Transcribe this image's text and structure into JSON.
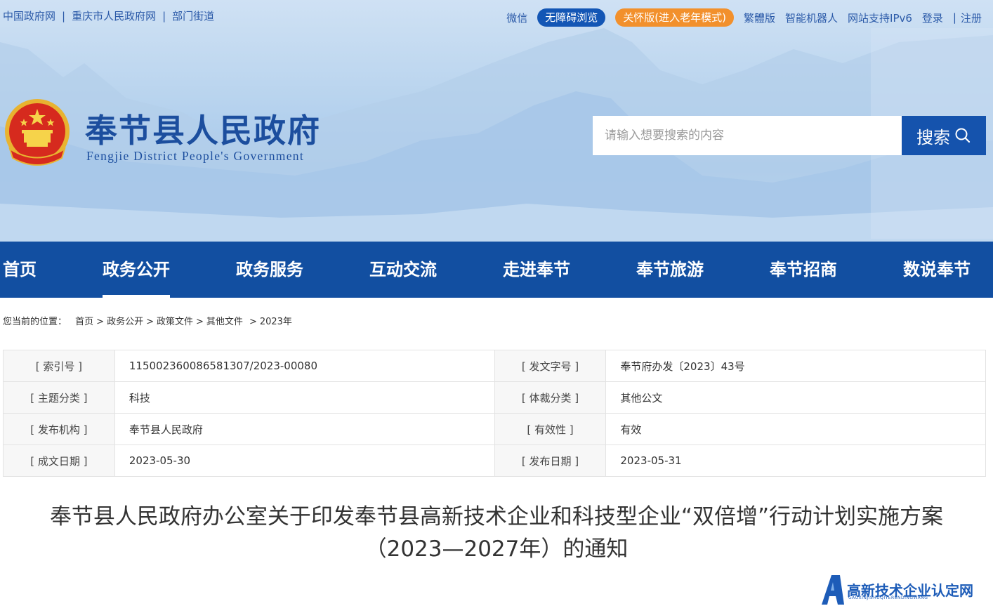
{
  "topbar": {
    "left_links": [
      "中国政府网",
      "重庆市人民政府网",
      "部门街道"
    ],
    "right": {
      "wechat": "微信",
      "accessible": "无障碍浏览",
      "elderly": "关怀版(进入老年模式)",
      "traditional": "繁體版",
      "robot": "智能机器人",
      "ipv6": "网站支持IPv6",
      "login": "登录",
      "register": "注册"
    }
  },
  "site": {
    "title": "奉节县人民政府",
    "subtitle": "Fengjie District People's Government"
  },
  "search": {
    "placeholder": "请输入想要搜索的内容",
    "button": "搜索"
  },
  "nav": {
    "items": [
      "首页",
      "政务公开",
      "政务服务",
      "互动交流",
      "走进奉节",
      "奉节旅游",
      "奉节招商",
      "数说奉节"
    ],
    "active_index": 1
  },
  "breadcrumb": {
    "prefix": "您当前的位置：",
    "items": [
      "首页",
      "政务公开",
      "政策文件",
      "其他文件",
      "2023年"
    ]
  },
  "meta": {
    "rows": [
      {
        "k1": "[ 索引号 ]",
        "v1": "11500236008658130​7/2023-00080",
        "k2": "[ 发文字号 ]",
        "v2": "奉节府办发〔2023〕43号"
      },
      {
        "k1": "[ 主题分类 ]",
        "v1": "科技",
        "k2": "[ 体裁分类 ]",
        "v2": "其他公文"
      },
      {
        "k1": "[ 发布机构 ]",
        "v1": "奉节县人民政府",
        "k2": "[ 有效性 ]",
        "v2": "有效"
      },
      {
        "k1": "[ 成文日期 ]",
        "v1": "2023-05-30",
        "k2": "[ 发布日期 ]",
        "v2": "2023-05-31"
      }
    ]
  },
  "document": {
    "title_line1": "奉节县人民政府办公室关于印发奉节县高新技术企业和科技型企业“双倍增”行动计划实施方案",
    "title_line2": "（2023—2027年）的通知"
  },
  "watermark": {
    "text": "高新技术企业认定网",
    "sub": "GAOXINJISHUQIYERENDINGWANG"
  },
  "colors": {
    "primary": "#124fa1",
    "accent_orange": "#f2902c",
    "link": "#2b5aa8"
  }
}
